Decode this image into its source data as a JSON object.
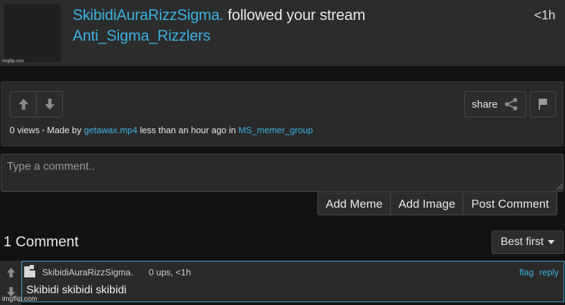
{
  "notification": {
    "username": "SkibidiAuraRizzSigma.",
    "action": "followed your stream",
    "stream": "Anti_Sigma_Rizzlers",
    "time": "<1h",
    "watermark": "imgflip.com"
  },
  "meta": {
    "views": "0 views",
    "made_by_prefix": "Made by",
    "author": "getawax.mp4",
    "time_text": "less than an hour ago in",
    "group": "MS_memer_group",
    "share_label": "share"
  },
  "comment_form": {
    "placeholder": "Type a comment..",
    "add_meme_label": "Add Meme",
    "add_image_label": "Add Image",
    "post_label": "Post Comment"
  },
  "comments": {
    "count_label": "1 Comment",
    "sort_label": "Best first",
    "items": [
      {
        "username": "SkibidiAuraRizzSigma.",
        "meta": "0 ups, <1h",
        "flag_label": "flag",
        "reply_label": "reply",
        "text": "Skibidi skibidi skibidi"
      }
    ]
  },
  "watermark": "imgflip.com",
  "colors": {
    "link": "#3bb0e0",
    "background": "#121212",
    "panel": "#2a2a2a"
  }
}
